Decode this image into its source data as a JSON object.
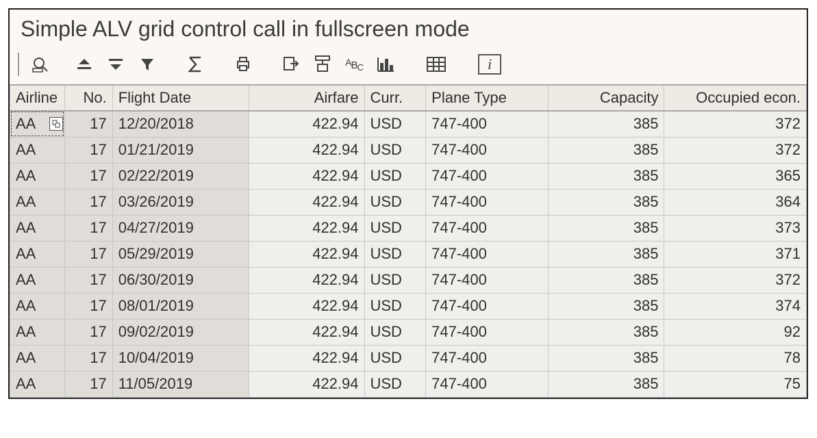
{
  "title": "Simple ALV grid control call in fullscreen mode",
  "toolbar": {
    "details": "details-icon",
    "sort_asc": "sort-ascending-icon",
    "sort_desc": "sort-descending-icon",
    "filter": "filter-icon",
    "sum": "sum-icon",
    "print": "print-icon",
    "export": "export-icon",
    "layout_change": "change-layout-icon",
    "abc": "abc-analysis-icon",
    "chart": "bar-chart-icon",
    "grid": "spreadsheet-icon",
    "info": "info-icon",
    "info_glyph": "i"
  },
  "columns": [
    {
      "key": "airline",
      "label": "Airline",
      "align": "left",
      "keycol": true
    },
    {
      "key": "no",
      "label": "No.",
      "align": "right",
      "keycol": true
    },
    {
      "key": "fldate",
      "label": "Flight Date",
      "align": "left",
      "keycol": true
    },
    {
      "key": "airfare",
      "label": "Airfare",
      "align": "right",
      "keycol": false
    },
    {
      "key": "curr",
      "label": "Curr.",
      "align": "left",
      "keycol": false
    },
    {
      "key": "plane",
      "label": "Plane Type",
      "align": "left",
      "keycol": false
    },
    {
      "key": "capacity",
      "label": "Capacity",
      "align": "right",
      "keycol": false
    },
    {
      "key": "occ",
      "label": "Occupied econ.",
      "align": "right",
      "keycol": false
    }
  ],
  "rows": [
    {
      "airline": "AA",
      "no": "17",
      "fldate": "12/20/2018",
      "airfare": "422.94",
      "curr": "USD",
      "plane": "747-400",
      "capacity": "385",
      "occ": "372"
    },
    {
      "airline": "AA",
      "no": "17",
      "fldate": "01/21/2019",
      "airfare": "422.94",
      "curr": "USD",
      "plane": "747-400",
      "capacity": "385",
      "occ": "372"
    },
    {
      "airline": "AA",
      "no": "17",
      "fldate": "02/22/2019",
      "airfare": "422.94",
      "curr": "USD",
      "plane": "747-400",
      "capacity": "385",
      "occ": "365"
    },
    {
      "airline": "AA",
      "no": "17",
      "fldate": "03/26/2019",
      "airfare": "422.94",
      "curr": "USD",
      "plane": "747-400",
      "capacity": "385",
      "occ": "364"
    },
    {
      "airline": "AA",
      "no": "17",
      "fldate": "04/27/2019",
      "airfare": "422.94",
      "curr": "USD",
      "plane": "747-400",
      "capacity": "385",
      "occ": "373"
    },
    {
      "airline": "AA",
      "no": "17",
      "fldate": "05/29/2019",
      "airfare": "422.94",
      "curr": "USD",
      "plane": "747-400",
      "capacity": "385",
      "occ": "371"
    },
    {
      "airline": "AA",
      "no": "17",
      "fldate": "06/30/2019",
      "airfare": "422.94",
      "curr": "USD",
      "plane": "747-400",
      "capacity": "385",
      "occ": "372"
    },
    {
      "airline": "AA",
      "no": "17",
      "fldate": "08/01/2019",
      "airfare": "422.94",
      "curr": "USD",
      "plane": "747-400",
      "capacity": "385",
      "occ": "374"
    },
    {
      "airline": "AA",
      "no": "17",
      "fldate": "09/02/2019",
      "airfare": "422.94",
      "curr": "USD",
      "plane": "747-400",
      "capacity": "385",
      "occ": "92"
    },
    {
      "airline": "AA",
      "no": "17",
      "fldate": "10/04/2019",
      "airfare": "422.94",
      "curr": "USD",
      "plane": "747-400",
      "capacity": "385",
      "occ": "78"
    },
    {
      "airline": "AA",
      "no": "17",
      "fldate": "11/05/2019",
      "airfare": "422.94",
      "curr": "USD",
      "plane": "747-400",
      "capacity": "385",
      "occ": "75"
    }
  ],
  "selected_row": 0,
  "col_widths": {
    "airline": 80,
    "no": 70,
    "fldate": 200,
    "airfare": 170,
    "curr": 90,
    "plane": 180,
    "capacity": 170,
    "occ": 208
  }
}
